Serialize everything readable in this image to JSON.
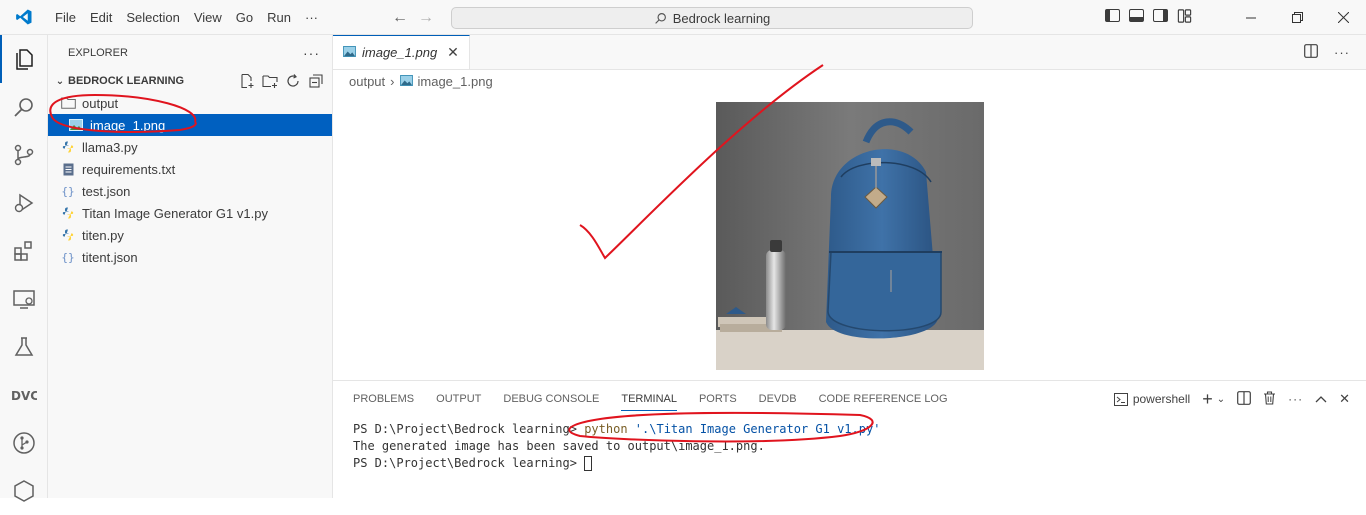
{
  "titlebar": {
    "menu": [
      "File",
      "Edit",
      "Selection",
      "View",
      "Go",
      "Run",
      "···"
    ],
    "search": "Bedrock learning"
  },
  "sidebar": {
    "title": "EXPLORER",
    "more": "···",
    "section": "BEDROCK LEARNING",
    "items": [
      {
        "label": "output",
        "icon": "folder-icon"
      },
      {
        "label": "image_1.png",
        "icon": "image-file-icon"
      },
      {
        "label": "llama3.py",
        "icon": "python-icon"
      },
      {
        "label": "requirements.txt",
        "icon": "text-file-icon"
      },
      {
        "label": "test.json",
        "icon": "json-icon"
      },
      {
        "label": "Titan Image Generator G1 v1.py",
        "icon": "python-icon"
      },
      {
        "label": "titen.py",
        "icon": "python-icon"
      },
      {
        "label": "titent.json",
        "icon": "json-icon"
      }
    ]
  },
  "editor": {
    "tab": "image_1.png",
    "breadcrumb": [
      "output",
      "image_1.png"
    ]
  },
  "panel": {
    "tabs": [
      "PROBLEMS",
      "OUTPUT",
      "DEBUG CONSOLE",
      "TERMINAL",
      "PORTS",
      "DEVDB",
      "CODE REFERENCE LOG"
    ],
    "active_tab": "TERMINAL",
    "shell": "powershell",
    "terminal": {
      "prompt": "PS D:\\Project\\Bedrock learning>",
      "cmd": "python",
      "arg": "'.\\Titan Image Generator G1 v1.py'",
      "line2": "The generated image has been saved to output\\image_1.png."
    }
  },
  "colors": {
    "accent": "#005fb8",
    "selection": "#0060c0",
    "annotation": "#e0141e"
  }
}
